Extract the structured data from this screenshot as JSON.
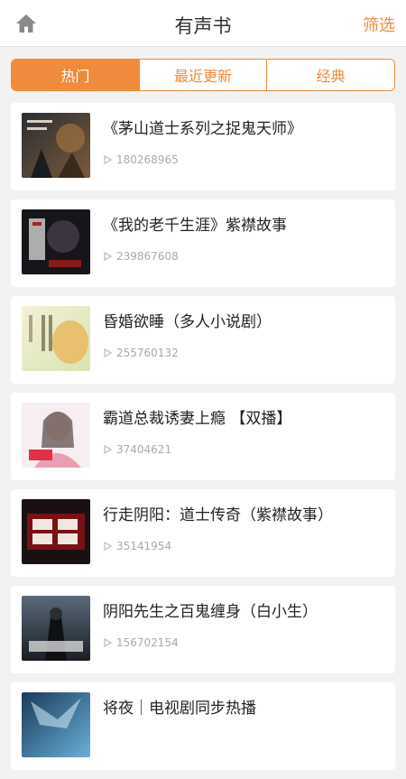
{
  "header": {
    "home_icon": "home-icon",
    "title": "有声书",
    "filter_label": "筛选"
  },
  "tabs": [
    {
      "label": "热门",
      "active": true
    },
    {
      "label": "最近更新",
      "active": false
    },
    {
      "label": "经典",
      "active": false
    }
  ],
  "books": [
    {
      "title": "《茅山道士系列之捉鬼天师》",
      "plays": "180268965"
    },
    {
      "title": "《我的老千生涯》紫襟故事",
      "plays": "239867608"
    },
    {
      "title": "昏婚欲睡（多人小说剧）",
      "plays": "255760132"
    },
    {
      "title": "霸道总裁诱妻上瘾 【双播】",
      "plays": "37404621"
    },
    {
      "title": "行走阴阳：道士传奇（紫襟故事）",
      "plays": "35141954"
    },
    {
      "title": "阴阳先生之百鬼缠身（白小生）",
      "plays": "156702154"
    },
    {
      "title": "将夜｜电视剧同步热播",
      "plays": ""
    }
  ],
  "colors": {
    "accent": "#f08a3c",
    "background": "#f2f2f2"
  }
}
